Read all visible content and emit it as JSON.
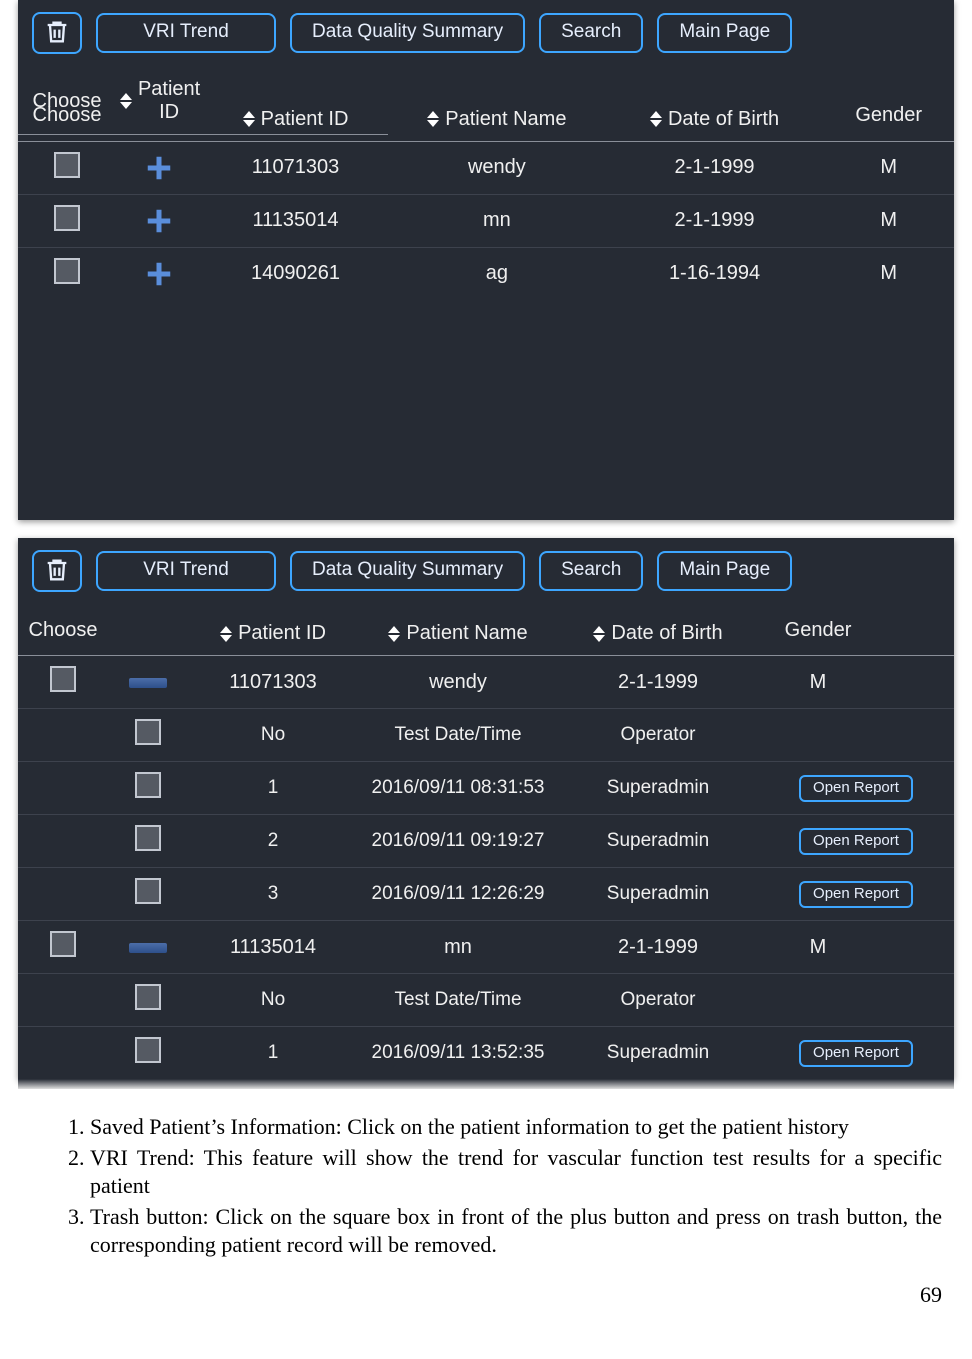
{
  "toolbar": {
    "vri_trend": "VRI Trend",
    "data_quality_summary": "Data Quality Summary",
    "search": "Search",
    "main_page": "Main Page",
    "open_report": "Open Report"
  },
  "headers": {
    "choose": "Choose",
    "patient_id": "Patient ID",
    "patient_name": "Patient Name",
    "dob": "Date of Birth",
    "gender": "Gender",
    "no": "No",
    "test_datetime": "Test Date/Time",
    "operator": "Operator"
  },
  "patients": [
    {
      "id": "11071303",
      "name": "wendy",
      "dob": "2-1-1999",
      "gender": "M"
    },
    {
      "id": "11135014",
      "name": "mn",
      "dob": "2-1-1999",
      "gender": "M"
    },
    {
      "id": "14090261",
      "name": "ag",
      "dob": "1-16-1994",
      "gender": "M"
    }
  ],
  "expanded": {
    "patient0": {
      "id": "11071303",
      "name": "wendy",
      "dob": "2-1-1999",
      "gender": "M",
      "tests": [
        {
          "no": "1",
          "dt": "2016/09/11 08:31:53",
          "op": "Superadmin"
        },
        {
          "no": "2",
          "dt": "2016/09/11 09:19:27",
          "op": "Superadmin"
        },
        {
          "no": "3",
          "dt": "2016/09/11 12:26:29",
          "op": "Superadmin"
        }
      ]
    },
    "patient1": {
      "id": "11135014",
      "name": "mn",
      "dob": "2-1-1999",
      "gender": "M",
      "tests": [
        {
          "no": "1",
          "dt": "2016/09/11 13:52:35",
          "op": "Superadmin"
        }
      ]
    }
  },
  "instructions": {
    "item1": "Saved Patient’s Information:  Click on the patient  information to get the patient history",
    "item2": "VRI Trend: This feature will show the trend for vascular function test results for a specific patient",
    "item3": "Trash button: Click on the square box in front of the plus button and press on trash button, the corresponding patient record will be removed."
  },
  "page_number": "69"
}
